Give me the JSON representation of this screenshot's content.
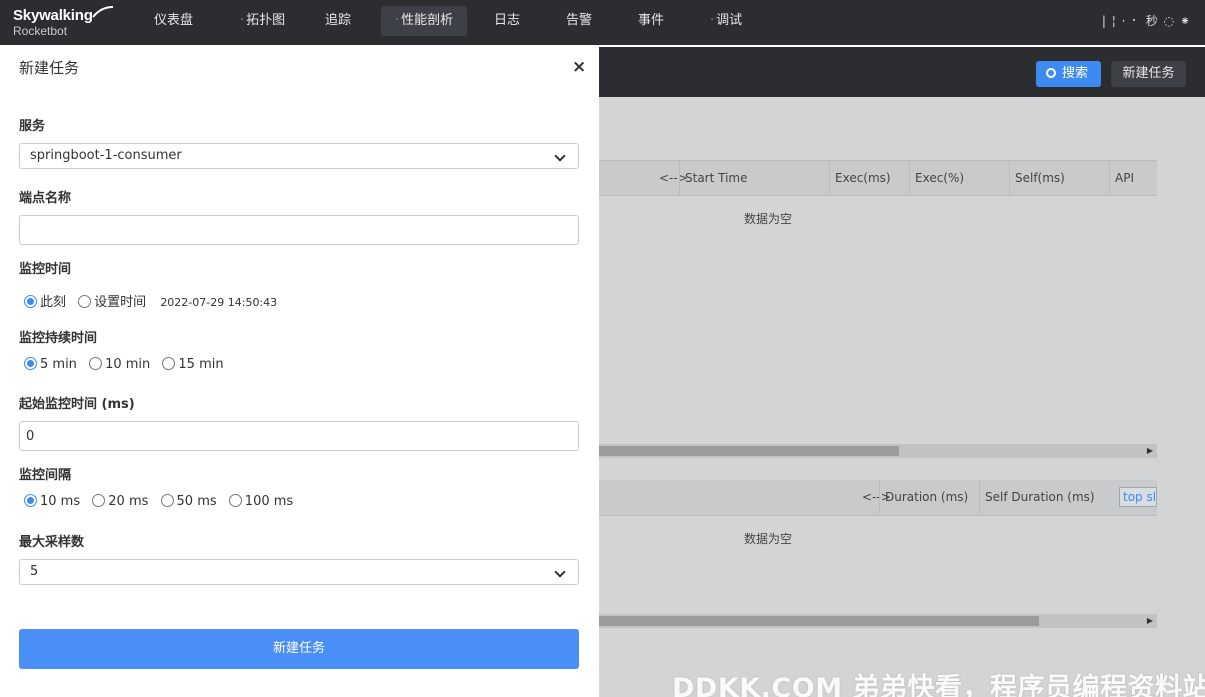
{
  "logo": {
    "line1": "Skywalking",
    "line2": "Rocketbot"
  },
  "nav": [
    {
      "label": "仪表盘",
      "active": false
    },
    {
      "label": "拓扑图",
      "active": false
    },
    {
      "label": "追踪",
      "active": false
    },
    {
      "label": "性能剖析",
      "active": true
    },
    {
      "label": "日志",
      "active": false
    },
    {
      "label": "告警",
      "active": false
    },
    {
      "label": "事件",
      "active": false
    },
    {
      "label": "调试",
      "active": false
    }
  ],
  "user": {
    "info": "| ¦ · ⠂ 秒 ◌ ⁕"
  },
  "toolbar": {
    "search_label": "搜索",
    "new_task_label": "新建任务"
  },
  "trace_table": {
    "headers": [
      "<-->",
      "Start Time",
      "Exec(ms)",
      "Exec(%)",
      "Self(ms)",
      "API"
    ],
    "empty": "数据为空"
  },
  "span_table": {
    "headers": [
      "<-->",
      "Duration (ms)",
      "Self Duration (ms)",
      "top slo"
    ],
    "empty": "数据为空"
  },
  "watermark": "DDKK.COM 弟弟快看，程序员编程资料站",
  "drawer": {
    "title": "新建任务",
    "close": "×",
    "service_label": "服务",
    "service_value": "springboot-1-consumer",
    "endpoint_label": "端点名称",
    "endpoint_value": "",
    "monitor_time_label": "监控时间",
    "monitor_time_options": [
      "此刻",
      "设置时间"
    ],
    "monitor_time_selected": 0,
    "monitor_time_value": "2022-07-29 14:50:43",
    "duration_label": "监控持续时间",
    "duration_options": [
      "5 min",
      "10 min",
      "15 min"
    ],
    "duration_selected": 0,
    "start_label": "起始监控时间 (ms)",
    "start_value": "0",
    "interval_label": "监控间隔",
    "interval_options": [
      "10 ms",
      "20 ms",
      "50 ms",
      "100 ms"
    ],
    "interval_selected": 0,
    "max_samples_label": "最大采样数",
    "max_samples_value": "5",
    "submit_label": "新建任务"
  },
  "colors": {
    "accent": "#4a8ff5",
    "topbar": "#2b2d31"
  }
}
